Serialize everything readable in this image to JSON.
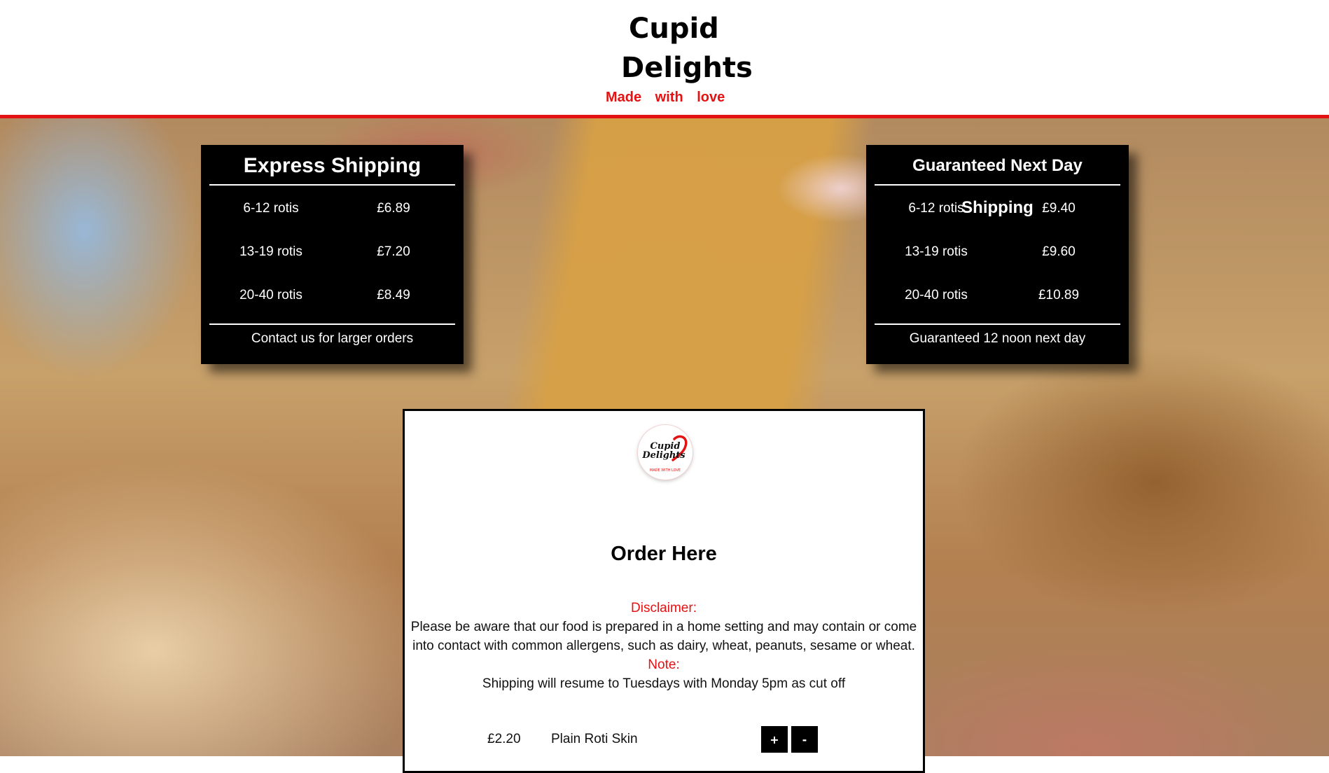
{
  "brand": {
    "name_line1": "Cupid",
    "name_line2": "Delights",
    "tagline": "Made with love",
    "accent_color": "#e41212"
  },
  "express_shipping": {
    "title": "Express Shipping",
    "rows": [
      {
        "qty": "6-12 rotis",
        "price": "£6.89"
      },
      {
        "qty": "13-19 rotis",
        "price": "£7.20"
      },
      {
        "qty": "20-40 rotis",
        "price": "£8.49"
      }
    ],
    "footer": "Contact us for larger orders"
  },
  "next_day_shipping": {
    "title": "Guaranteed Next Day Shipping",
    "rows": [
      {
        "qty": "6-12 rotis",
        "price": "£9.40"
      },
      {
        "qty": "13-19 rotis",
        "price": "£9.60"
      },
      {
        "qty": "20-40 rotis",
        "price": "£10.89"
      }
    ],
    "footer": "Guaranteed 12 noon next day"
  },
  "order": {
    "logo": {
      "line1": "Cupid",
      "line2": "Delights",
      "ring_text": "MADE WITH LOVE"
    },
    "title": "Order Here",
    "disclaimer_label": "Disclaimer:",
    "disclaimer_text": "Please be aware that our food is prepared in a home setting and may contain or come into contact with common allergens, such as dairy, wheat, peanuts, sesame or wheat.",
    "note_label": "Note:",
    "note_text": "Shipping will resume to Tuesdays with Monday 5pm as cut off",
    "products": [
      {
        "price": "£2.20",
        "name": "Plain Roti Skin",
        "plus_label": "+",
        "minus_label": "-"
      }
    ]
  }
}
